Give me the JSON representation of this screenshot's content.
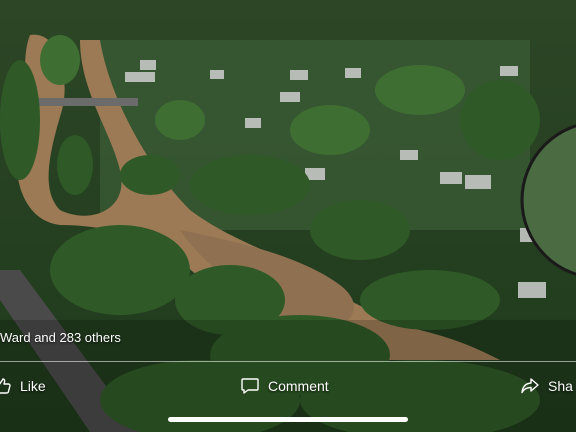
{
  "post": {
    "reactions_text": "Ward and 283 others"
  },
  "actions": {
    "like_label": "Like",
    "comment_label": "Comment",
    "share_label": "Sha"
  },
  "icons": {
    "like": "thumbs-up-icon",
    "comment": "speech-bubble-icon",
    "share": "share-arrow-icon"
  },
  "colors": {
    "overlay_text": "#ffffff",
    "floodwater": "#9b7a55",
    "foliage": "#2f5a27"
  }
}
